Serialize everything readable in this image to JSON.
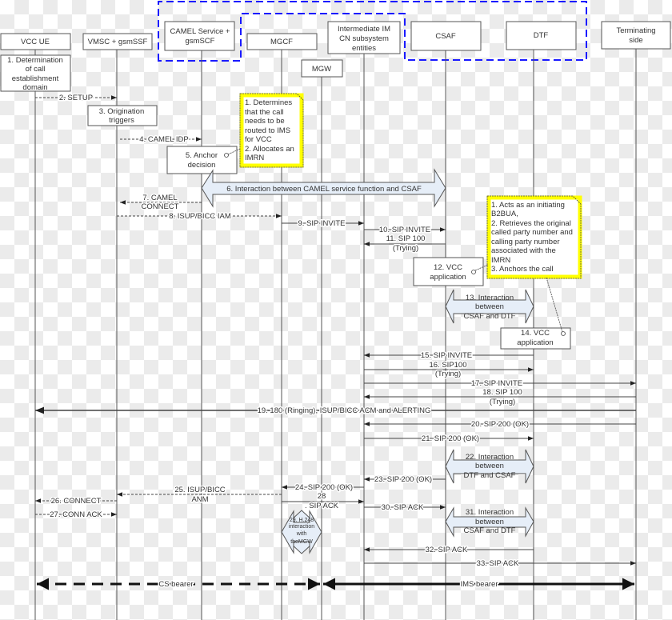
{
  "participants": {
    "vcc_ue": [
      "VCC UE"
    ],
    "vmsc": [
      "VMSC + gsmSSF"
    ],
    "camel": [
      "CAMEL Service +",
      "gsmSCF"
    ],
    "mgcf": [
      "MGCF"
    ],
    "mgw": [
      "MGW"
    ],
    "imcn": [
      "Intermediate IM",
      "CN subsystem",
      "entities"
    ],
    "csaf": [
      "CSAF"
    ],
    "dtf": [
      "DTF"
    ],
    "term": [
      "Terminating",
      "side"
    ]
  },
  "colors": {
    "group_border": "#1a1aff",
    "note_border": "#ffff00",
    "interaction_fill": "#e6eef8"
  },
  "steps": {
    "s1": [
      "1. Determination",
      "of call",
      "establishment",
      "domain"
    ],
    "s2": "2. SETUP",
    "s3": [
      "3. Origination",
      "triggers"
    ],
    "s4": "4. CAMEL IDP",
    "s5": [
      "5. Anchor",
      "decision"
    ],
    "s6": "6. Interaction between CAMEL service function and CSAF",
    "s7": [
      "7. CAMEL",
      "CONNECT"
    ],
    "s8": "8. ISUP/BICC IAM",
    "s9": "9. SIP INVITE",
    "s10": "10. SIP INVITE",
    "s11": [
      "11. SIP 100",
      "(Trying)"
    ],
    "s12": [
      "12. VCC",
      "application"
    ],
    "s13": [
      "13. Interaction",
      "between",
      "CSAF and DTF"
    ],
    "s14": [
      "14. VCC",
      "application"
    ],
    "s15": "15. SIP INVITE",
    "s16": [
      "16. SIP100",
      "(Trying)"
    ],
    "s17": "17. SIP INVITE",
    "s18": [
      "18. SIP 100",
      "(Trying)"
    ],
    "s19": "19.  180 (Ringing), ISUP/BICC ACM and ALERTING",
    "s20": "20. SIP 200 (OK)",
    "s21": "21. SIP 200 (OK)",
    "s22": [
      "22. Interaction",
      "between",
      "DTF and CSAF"
    ],
    "s23": "23. SIP 200 (OK)",
    "s24": "24. SIP 200 (OK)",
    "s25": [
      "25. ISUP/BICC",
      "ANM"
    ],
    "s26": "26. CONNECT",
    "s27": "27. CONN ACK",
    "s28": [
      "28",
      ". SIP ACK"
    ],
    "s29": [
      "29. H.248",
      "interaction",
      "with",
      "theMGW"
    ],
    "s30": "30. SIP ACK",
    "s31": [
      "31. Interaction",
      "between",
      "CSAF and DTF"
    ],
    "s32": "32. SIP ACK",
    "s33": "33. SIP ACK",
    "cs_bearer": "CS bearer",
    "ims_bearer": "IMS bearer"
  },
  "notes": {
    "camel_note": [
      "1. Determines",
      "that the call",
      "needs to be",
      "routed to IMS",
      "for VCC",
      "2. Allocates an",
      "IMRN"
    ],
    "csaf_note": [
      "1. Acts as an initiating",
      "B2BUA,",
      "2. Retrieves the original",
      "called party number and",
      "calling party number",
      "associated with the",
      "IMRN",
      "3. Anchors the call"
    ]
  }
}
